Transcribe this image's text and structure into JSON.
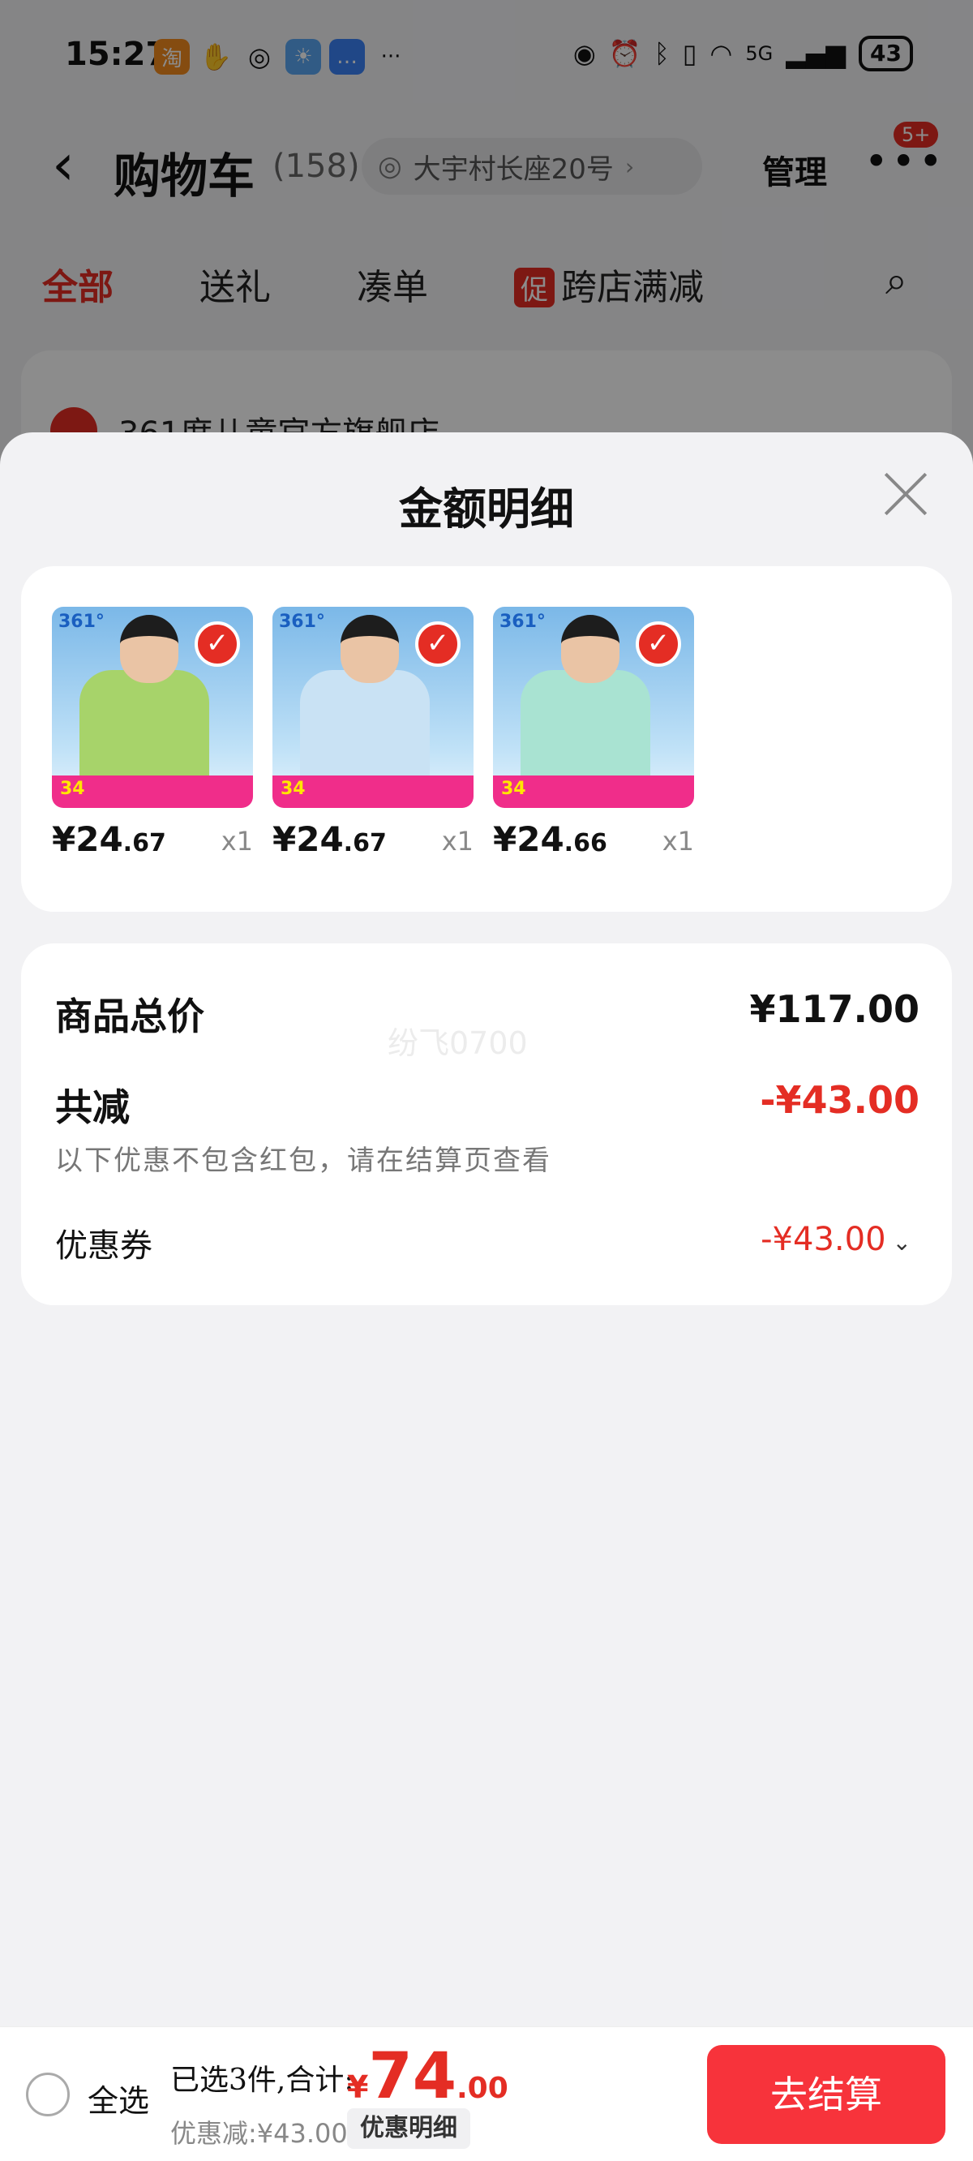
{
  "status_bar": {
    "time": "15:27",
    "battery": "43",
    "network": "5G"
  },
  "nav": {
    "title": "购物车",
    "count": "(158)",
    "address": "大宇村长座20号",
    "manage": "管理",
    "more_badge": "5+"
  },
  "tabs": [
    {
      "label": "全部"
    },
    {
      "label": "送礼"
    },
    {
      "label": "凑单"
    },
    {
      "label": "跨店满减",
      "tag": "促"
    }
  ],
  "shop": {
    "name": "361度儿童官方旗舰店"
  },
  "sheet": {
    "title": "金额明细",
    "items": [
      {
        "price_int": "¥24",
        "price_dec": ".67",
        "qty": "x1",
        "brand": "361°",
        "promo": "34",
        "color": "#a7d36a"
      },
      {
        "price_int": "¥24",
        "price_dec": ".67",
        "qty": "x1",
        "brand": "361°",
        "promo": "34",
        "color": "#c9e2f4"
      },
      {
        "price_int": "¥24",
        "price_dec": ".66",
        "qty": "x1",
        "brand": "361°",
        "promo": "34",
        "color": "#a9e3d2"
      }
    ],
    "summary": {
      "total_label": "商品总价",
      "total_value": "¥117.00",
      "reduce_label": "共减",
      "reduce_value": "-¥43.00",
      "note": "以下优惠不包含红包，请在结算页查看",
      "coupon_label": "优惠券",
      "coupon_value": "-¥43.00",
      "watermark": "纷飞0700"
    }
  },
  "bottom": {
    "select_all": "全选",
    "selected_text": "已选3件,合计:",
    "total_currency": "¥",
    "total_int": "74",
    "total_dec": ".00",
    "discount": "优惠减:¥43.00",
    "detail_button": "优惠明细",
    "checkout": "去结算"
  },
  "colors": {
    "accent": "#e42d24",
    "checkout": "#f7333b"
  }
}
